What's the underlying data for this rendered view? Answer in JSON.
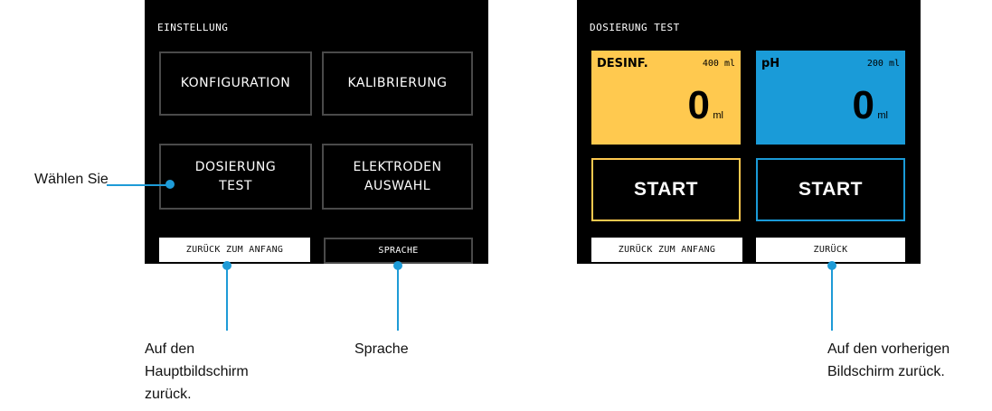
{
  "accent_color": "#1e9bd7",
  "screen1": {
    "title": "EINSTELLUNG",
    "buttons": {
      "konfiguration": "KONFIGURATION",
      "kalibrierung": "KALIBRIERUNG",
      "dosierung_line1": "DOSIERUNG",
      "dosierung_line2": "TEST",
      "elektroden_line1": "ELEKTRODEN",
      "elektroden_line2": "AUSWAHL"
    },
    "back_to_start": "ZURÜCK ZUM ANFANG",
    "language": "SPRACHE"
  },
  "screen2": {
    "title": "DOSIERUNG TEST",
    "tiles": [
      {
        "name": "DESINF.",
        "capacity": "400 ml",
        "value": "0",
        "unit": "ml",
        "color": "#ffc94f"
      },
      {
        "name": "pH",
        "capacity": "200 ml",
        "value": "0",
        "unit": "ml",
        "color": "#1a9bd8"
      }
    ],
    "start_left": "START",
    "start_right": "START",
    "back_to_start": "ZURÜCK ZUM ANFANG",
    "back": "ZURÜCK"
  },
  "callouts": {
    "select": "Wählen Sie",
    "home_line1": "Auf den",
    "home_line2": "Hauptbildschirm",
    "home_line3": "zurück.",
    "language": "Sprache",
    "previous_line1": "Auf den vorherigen",
    "previous_line2": "Bildschirm zurück."
  }
}
